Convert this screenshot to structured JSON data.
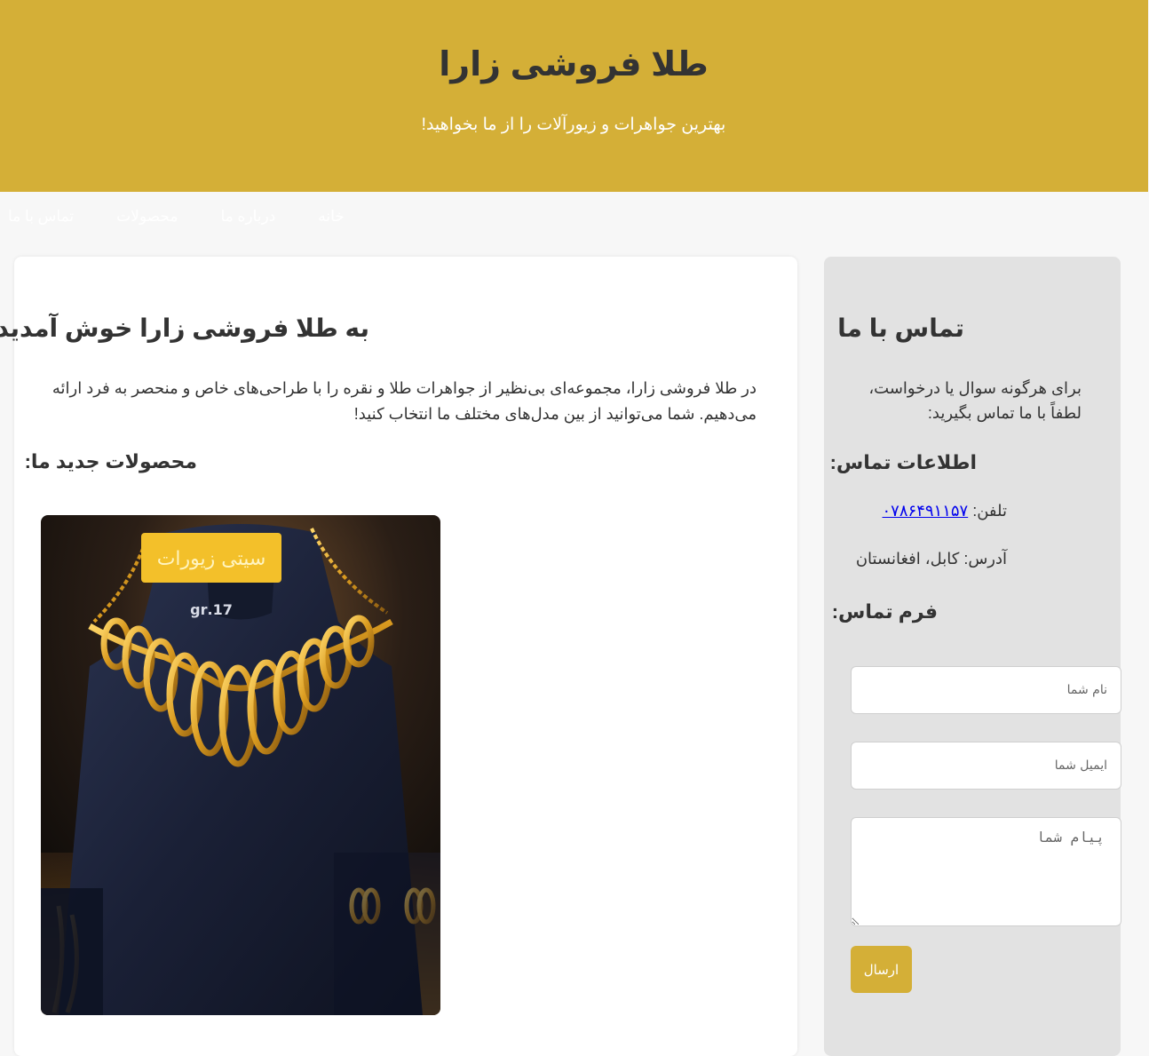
{
  "header": {
    "title": "طلا فروشی زارا",
    "tagline": "بهترین جواهرات و زیورآلات را از ما بخواهید!"
  },
  "nav": {
    "items": [
      {
        "label": "خانه"
      },
      {
        "label": "درباره ما"
      },
      {
        "label": "محصولات"
      },
      {
        "label": "تماس با ما"
      }
    ]
  },
  "main": {
    "heading": "به طلا فروشی زارا خوش آمدید",
    "intro": "در طلا فروشی زارا، مجموعه‌ای بی‌نظیر از جواهرات طلا و نقره را با طراحی‌های خاص و منحصر به فرد ارائه می‌دهیم. شما می‌توانید از بین مدل‌های مختلف ما انتخاب کنید!",
    "new_products_heading": "محصولات جدید ما:",
    "product_image": {
      "badge_text": "سیتی زیورات",
      "weight_text": "17.gr"
    }
  },
  "sidebar": {
    "heading": "تماس با ما",
    "lead": "برای هرگونه سوال یا درخواست، لطفاً با ما تماس بگیرید:",
    "info_heading": "اطلاعات تماس:",
    "phone_label": "تلفن:",
    "phone_value": "۰۷۸۶۴۹۱۱۵۷",
    "address_label": "آدرس:",
    "address_value": "کابل، افغانستان",
    "form_heading": "فرم تماس:",
    "name_placeholder": "نام شما",
    "email_placeholder": "ایمیل شما",
    "message_placeholder": "پیام شما",
    "submit_label": "ارسال"
  },
  "colors": {
    "accent": "#d4af37",
    "page_bg": "#f7f7f7",
    "sidebar_bg": "#e2e2e2",
    "link": "#0000ee"
  }
}
